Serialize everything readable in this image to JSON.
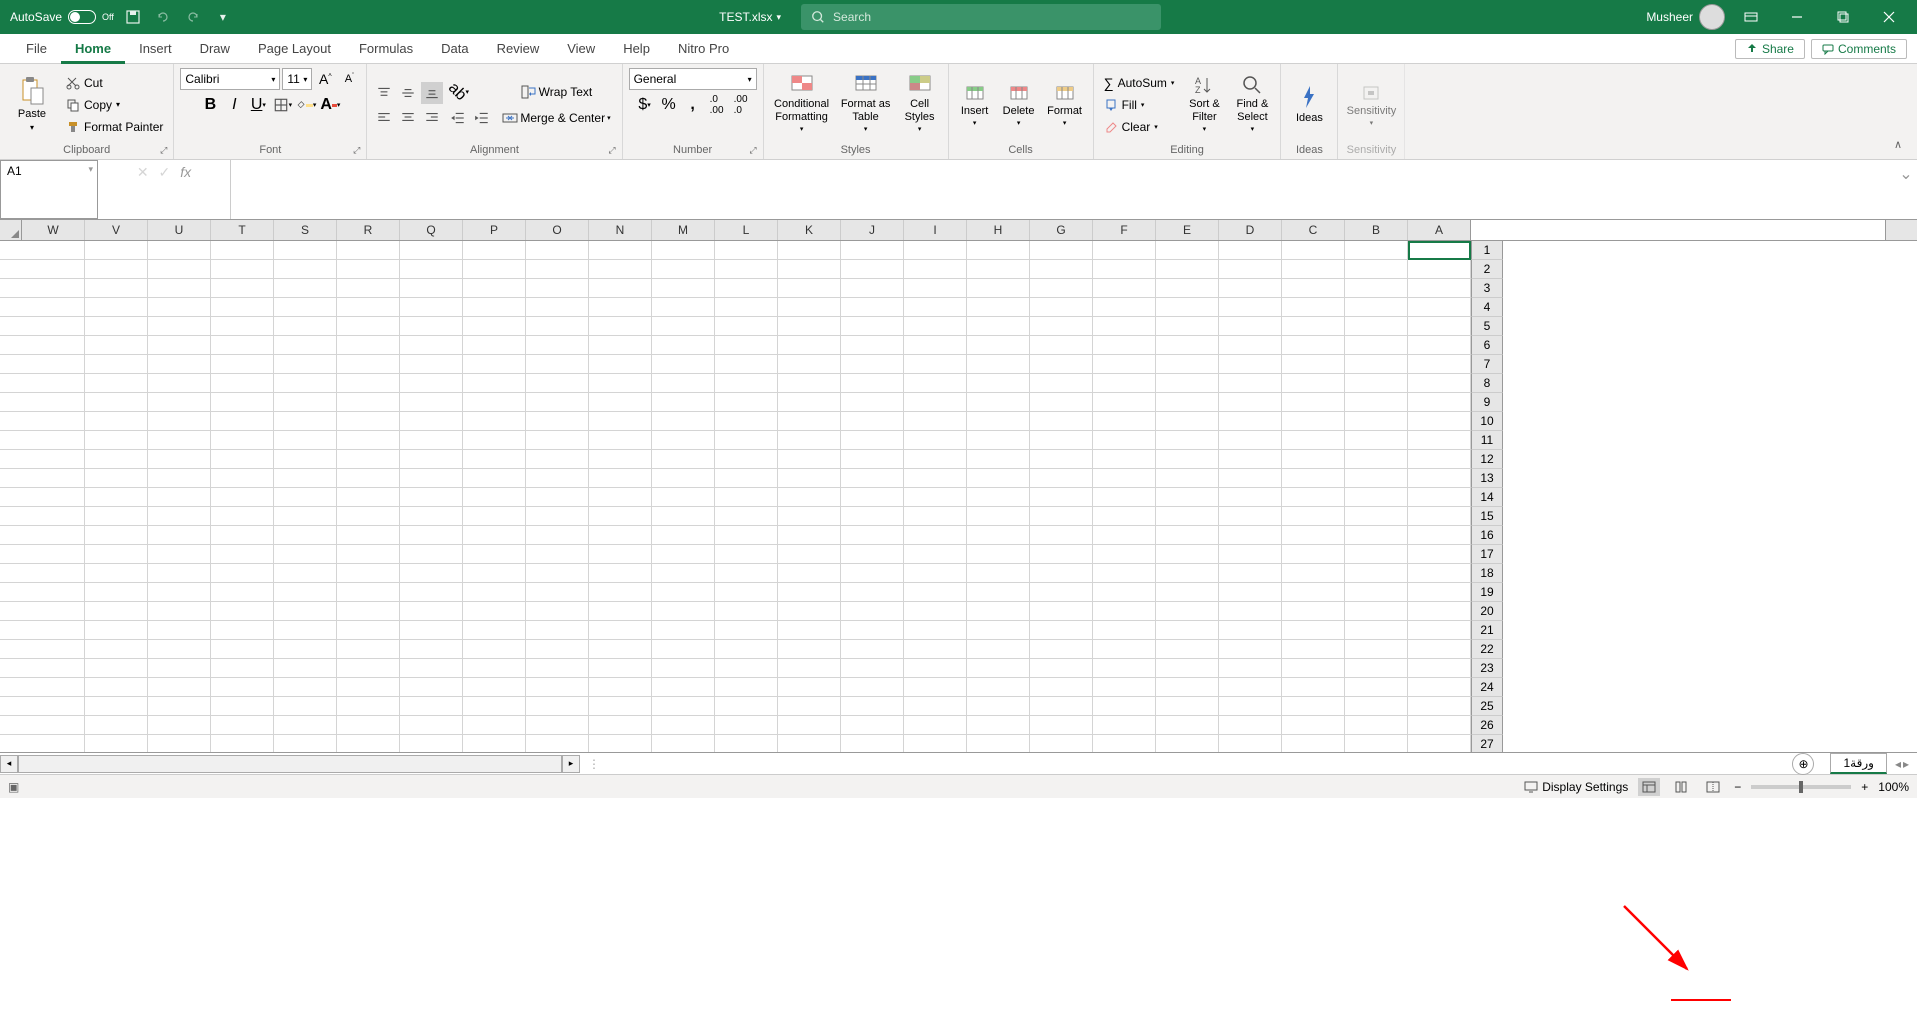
{
  "title_bar": {
    "autosave_label": "AutoSave",
    "autosave_state": "Off",
    "document_name": "TEST.xlsx",
    "search_placeholder": "Search",
    "user_name": "Musheer"
  },
  "ribbon_tabs": [
    "File",
    "Home",
    "Insert",
    "Draw",
    "Page Layout",
    "Formulas",
    "Data",
    "Review",
    "View",
    "Help",
    "Nitro Pro"
  ],
  "ribbon_active": "Home",
  "share_label": "Share",
  "comments_label": "Comments",
  "clipboard": {
    "paste": "Paste",
    "cut": "Cut",
    "copy": "Copy",
    "format_painter": "Format Painter",
    "group": "Clipboard"
  },
  "font": {
    "name": "Calibri",
    "size": "11",
    "group": "Font"
  },
  "alignment": {
    "wrap": "Wrap Text",
    "merge": "Merge & Center",
    "group": "Alignment"
  },
  "number": {
    "format": "General",
    "group": "Number"
  },
  "styles": {
    "cond": "Conditional Formatting",
    "table": "Format as Table",
    "cell": "Cell Styles",
    "group": "Styles"
  },
  "cells": {
    "insert": "Insert",
    "delete": "Delete",
    "format": "Format",
    "group": "Cells"
  },
  "editing": {
    "autosum": "AutoSum",
    "fill": "Fill",
    "clear": "Clear",
    "sort": "Sort & Filter",
    "find": "Find & Select",
    "group": "Editing"
  },
  "ideas": {
    "label": "Ideas",
    "group": "Ideas"
  },
  "sensitivity": {
    "label": "Sensitivity",
    "group": "Sensitivity"
  },
  "name_box": "A1",
  "columns": [
    "W",
    "V",
    "U",
    "T",
    "S",
    "R",
    "Q",
    "P",
    "O",
    "N",
    "M",
    "L",
    "K",
    "J",
    "I",
    "H",
    "G",
    "F",
    "E",
    "D",
    "C",
    "B",
    "A"
  ],
  "rows": [
    1,
    2,
    3,
    4,
    5,
    6,
    7,
    8,
    9,
    10,
    11,
    12,
    13,
    14,
    15,
    16,
    17,
    18,
    19,
    20,
    21,
    22,
    23,
    24,
    25,
    26,
    27
  ],
  "sheet_tab_name": "ورقة1",
  "status": {
    "display_settings": "Display Settings",
    "zoom": "100%"
  }
}
